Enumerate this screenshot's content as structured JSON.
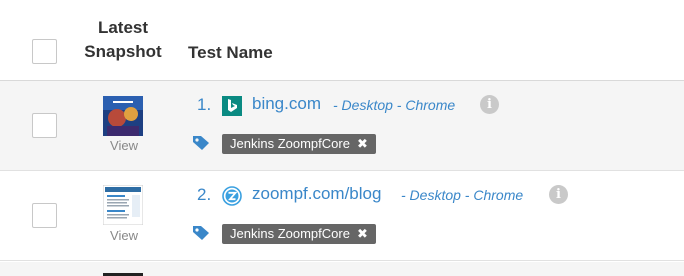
{
  "header": {
    "snapshot_label_line1": "Latest",
    "snapshot_label_line2": "Snapshot",
    "test_name_label": "Test Name"
  },
  "rows": [
    {
      "index": "1.",
      "site_icon": "bing-icon",
      "url": "bing.com",
      "meta": "- Desktop - Chrome",
      "view_label": "View",
      "info_glyph": "i",
      "tag_label": "Jenkins ZoompfCore",
      "tag_remove_glyph": "✖"
    },
    {
      "index": "2.",
      "site_icon": "zoompf-icon",
      "url": "zoompf.com/blog",
      "meta": "- Desktop - Chrome",
      "view_label": "View",
      "info_glyph": "i",
      "tag_label": "Jenkins ZoompfCore",
      "tag_remove_glyph": "✖"
    }
  ],
  "colors": {
    "link": "#3a87c9",
    "tag_bg": "#666666",
    "info_bg": "#c9c9c9",
    "bing_teal": "#0a8a82"
  }
}
